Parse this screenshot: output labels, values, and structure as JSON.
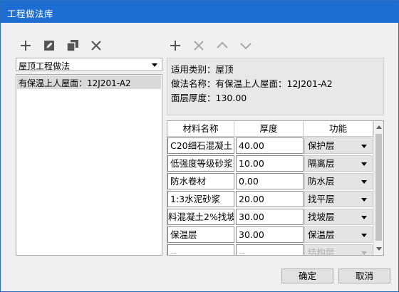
{
  "window": {
    "title": "工程做法库"
  },
  "left_toolbar": {
    "add": "add-icon",
    "edit": "edit-icon",
    "copy": "copy-icon",
    "delete": "delete-icon"
  },
  "right_toolbar": {
    "add": "add-icon",
    "delete": "delete-icon",
    "move_up": "chevron-up-icon",
    "move_down": "chevron-down-icon"
  },
  "category_select": {
    "value": "屋顶工程做法"
  },
  "practice_list": {
    "items": [
      "有保温上人屋面：12J201-A2"
    ]
  },
  "info": {
    "category": "适用类别：屋顶",
    "name": "做法名称：有保温上人屋面：12J201-A2",
    "thickness": "面层厚度：130.00"
  },
  "layers_table": {
    "headers": [
      "材料名称",
      "厚度",
      "功能"
    ],
    "rows": [
      {
        "material": "C20细石混凝土",
        "thickness": "40.00",
        "function": "保护层"
      },
      {
        "material": "低强度等级砂浆",
        "thickness": "10.00",
        "function": "隔离层"
      },
      {
        "material": "防水卷材",
        "thickness": "0.00",
        "function": "防水层"
      },
      {
        "material": "1:3水泥砂浆",
        "thickness": "20.00",
        "function": "找平层"
      },
      {
        "material": "料混凝土2%找坡",
        "thickness": "30.00",
        "function": "找坡层"
      },
      {
        "material": "保温层",
        "thickness": "30.00",
        "function": "保温层"
      },
      {
        "material": "--",
        "thickness": "--",
        "function": "结构层"
      }
    ]
  },
  "buttons": {
    "ok": "确定",
    "cancel": "取消"
  },
  "colors": {
    "titlebar": "#1e6dd1",
    "icon": "#555555",
    "icon_disabled": "#a8a8a8"
  }
}
